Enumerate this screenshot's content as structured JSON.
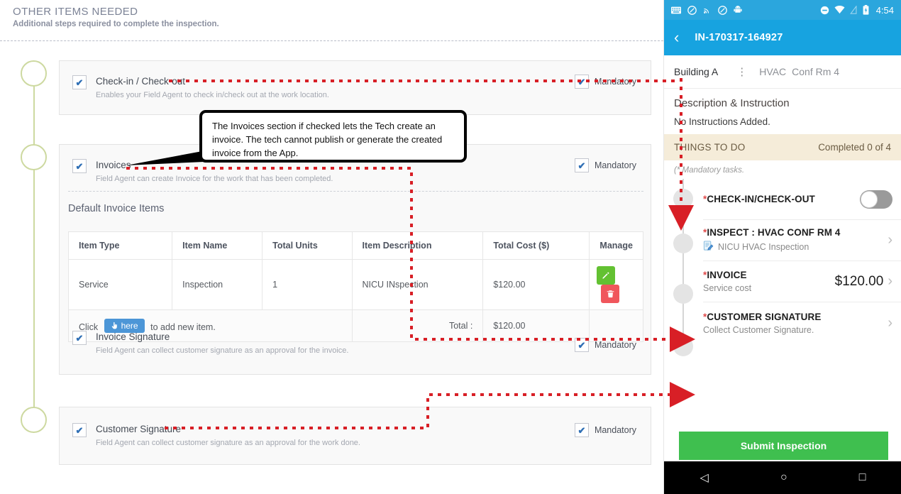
{
  "web": {
    "section": {
      "title": "OTHER ITEMS NEEDED",
      "subtitle": "Additional steps required to complete the inspection."
    },
    "mandatory_label": "Mandatory",
    "check_glyph": "✔",
    "items": [
      {
        "label": "Check-in / Check-out",
        "desc": "Enables your Field Agent to check in/check out at the work location."
      },
      {
        "label": "Invoices",
        "desc": "Field Agent can create Invoice for the work that has been completed."
      },
      {
        "label": "Invoice Signature",
        "desc": "Field Agent can collect customer signature as an approval for the invoice."
      },
      {
        "label": "Customer Signature",
        "desc": "Field Agent can collect customer signature as an approval for the work done."
      }
    ],
    "invoice": {
      "default_items_title": "Default Invoice Items",
      "columns": [
        "Item Type",
        "Item Name",
        "Total Units",
        "Item Description",
        "Total Cost ($)",
        "Manage"
      ],
      "rows": [
        {
          "type": "Service",
          "name": "Inspection",
          "units": "1",
          "description": "NICU INspection",
          "cost": "$120.00",
          "edit_glyph": "✎",
          "delete_glyph": "Ὕ1"
        }
      ],
      "add_prefix": "Click",
      "add_button": "here",
      "add_suffix": "to add new item.",
      "add_icon_glyph": "☝",
      "total_label": "Total :",
      "total_value": "$120.00"
    }
  },
  "callout": {
    "text": "The Invoices section if checked lets the Tech create an invoice. The tech cannot publish or generate the created invoice from the App."
  },
  "phone": {
    "statusbar": {
      "icons": [
        "keyboard-icon",
        "sync-icon",
        "cast-icon",
        "sync-alt-icon",
        "android-icon"
      ],
      "right_icons": [
        "dnd-icon",
        "wifi-icon",
        "signal-icon",
        "battery-icon"
      ],
      "time": "4:54"
    },
    "appbar": {
      "back_glyph": "‹",
      "title": "IN-170317-164927"
    },
    "location": {
      "building": "Building A",
      "separator": "⋮",
      "system": "HVAC",
      "room": "Conf Rm 4"
    },
    "description": {
      "heading": "Description & Instruction",
      "body": "No Instructions Added."
    },
    "todo": {
      "heading": "THINGS TO DO",
      "completed": "Completed 0 of 4",
      "note": "(* Mandatory tasks."
    },
    "tasks": [
      {
        "star": "*",
        "title": "CHECK-IN/CHECK-OUT",
        "subtitle": "",
        "control": "toggle"
      },
      {
        "star": "*",
        "title": "INSPECT : HVAC CONF RM 4",
        "subtitle": "NICU HVAC Inspection",
        "control": "chevron",
        "sub_icon": "form-icon"
      },
      {
        "star": "*",
        "title": "INVOICE",
        "subtitle": "Service cost",
        "amount": "$120.00",
        "control": "chevron"
      },
      {
        "star": "*",
        "title": "CUSTOMER SIGNATURE",
        "subtitle": "Collect Customer Signature.",
        "control": "chevron"
      }
    ],
    "submit_label": "Submit Inspection",
    "navbar": {
      "back_glyph": "◁",
      "home_glyph": "○",
      "recent_glyph": "□"
    }
  },
  "colors": {
    "accent_blue": "#17a3e0",
    "status_blue": "#2ba6dd",
    "annotation_red": "#d81f26",
    "timeline_green": "#cdd9a0",
    "submit_green": "#3fbf4f",
    "todo_bg": "#f5ecd9"
  }
}
